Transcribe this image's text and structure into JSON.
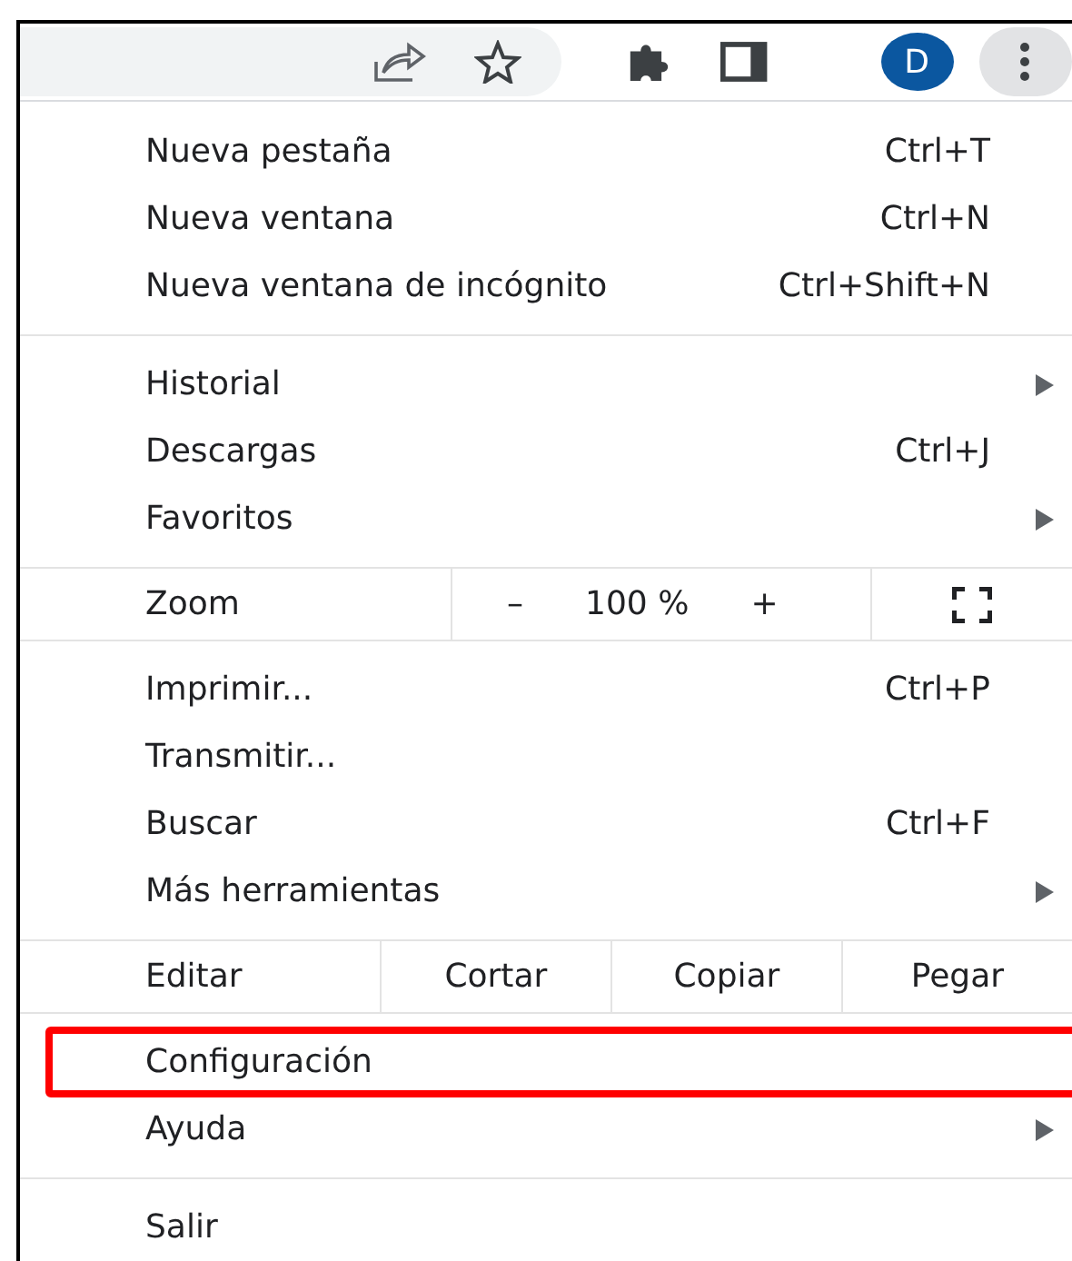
{
  "toolbar": {
    "avatar_letter": "D"
  },
  "menu": {
    "groups": [
      {
        "kind": "items",
        "items": [
          {
            "label": "Nueva pestaña",
            "shortcut": "Ctrl+T",
            "submenu": false,
            "highlighted": false
          },
          {
            "label": "Nueva ventana",
            "shortcut": "Ctrl+N",
            "submenu": false,
            "highlighted": false
          },
          {
            "label": "Nueva ventana de incógnito",
            "shortcut": "Ctrl+Shift+N",
            "submenu": false,
            "highlighted": false
          }
        ]
      },
      {
        "kind": "items",
        "items": [
          {
            "label": "Historial",
            "submenu": true,
            "highlighted": false
          },
          {
            "label": "Descargas",
            "shortcut": "Ctrl+J",
            "submenu": false,
            "highlighted": false
          },
          {
            "label": "Favoritos",
            "submenu": true,
            "highlighted": false
          }
        ]
      },
      {
        "kind": "zoom",
        "label": "Zoom",
        "minus": "–",
        "value": "100 %",
        "plus": "+"
      },
      {
        "kind": "items",
        "items": [
          {
            "label": "Imprimir...",
            "shortcut": "Ctrl+P",
            "submenu": false,
            "highlighted": false
          },
          {
            "label": "Transmitir...",
            "submenu": false,
            "highlighted": false
          },
          {
            "label": "Buscar",
            "shortcut": "Ctrl+F",
            "submenu": false,
            "highlighted": false
          },
          {
            "label": "Más herramientas",
            "submenu": true,
            "highlighted": false
          }
        ]
      },
      {
        "kind": "edit",
        "label": "Editar",
        "actions": [
          "Cortar",
          "Copiar",
          "Pegar"
        ]
      },
      {
        "kind": "items",
        "items": [
          {
            "label": "Configuración",
            "submenu": false,
            "highlighted": true
          },
          {
            "label": "Ayuda",
            "submenu": true,
            "highlighted": false
          }
        ]
      },
      {
        "kind": "items",
        "items": [
          {
            "label": "Salir",
            "submenu": false,
            "highlighted": false
          }
        ]
      }
    ]
  }
}
